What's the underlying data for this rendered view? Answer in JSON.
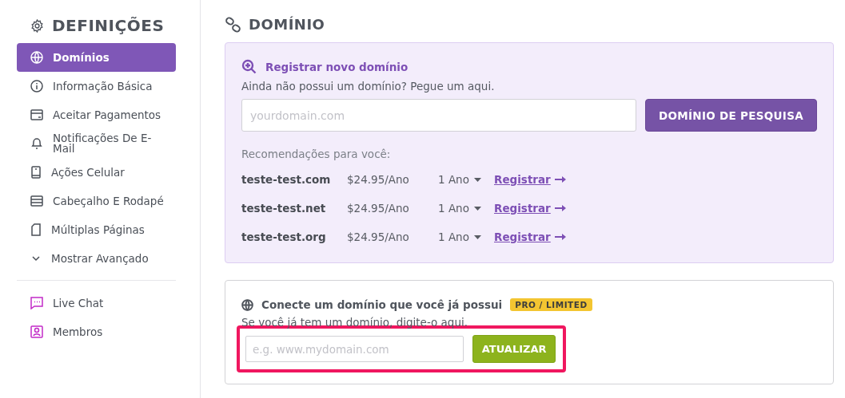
{
  "sidebar": {
    "title": "DEFINIÇÕES",
    "items": [
      {
        "label": "Domínios",
        "selected": true
      },
      {
        "label": "Informação Básica",
        "selected": false
      },
      {
        "label": "Aceitar Pagamentos",
        "selected": false
      },
      {
        "label": "Notificações De E-Mail",
        "selected": false
      },
      {
        "label": "Ações Celular",
        "selected": false
      },
      {
        "label": "Cabeçalho E Rodapé",
        "selected": false
      },
      {
        "label": "Múltiplas Páginas",
        "selected": false
      },
      {
        "label": "Mostrar Avançado",
        "selected": false
      }
    ],
    "extra_items": [
      {
        "label": "Live Chat"
      },
      {
        "label": "Membros"
      }
    ]
  },
  "main": {
    "title": "DOMÍNIO",
    "register": {
      "title": "Registrar novo domínio",
      "subtitle": "Ainda não possui um domínio? Pegue um aqui.",
      "search": {
        "placeholder": "yourdomain.com"
      },
      "button": "DOMÍNIO DE PESQUISA",
      "recommendations_label": "Recomendações para você:",
      "rows": [
        {
          "domain": "teste-test.com",
          "price": "$24.95/Ano",
          "term": "1 Ano",
          "action": "Registrar"
        },
        {
          "domain": "teste-test.net",
          "price": "$24.95/Ano",
          "term": "1 Ano",
          "action": "Registrar"
        },
        {
          "domain": "teste-test.org",
          "price": "$24.95/Ano",
          "term": "1 Ano",
          "action": "Registrar"
        }
      ]
    },
    "connect": {
      "title": "Conecte um domínio que você já possui",
      "badge": "PRO / LIMITED",
      "subtitle": "Se você já tem um domínio, digite-o aqui.",
      "field": {
        "placeholder": "e.g. www.mydomain.com"
      },
      "button": "ATUALIZAR",
      "highlighted": true
    }
  }
}
